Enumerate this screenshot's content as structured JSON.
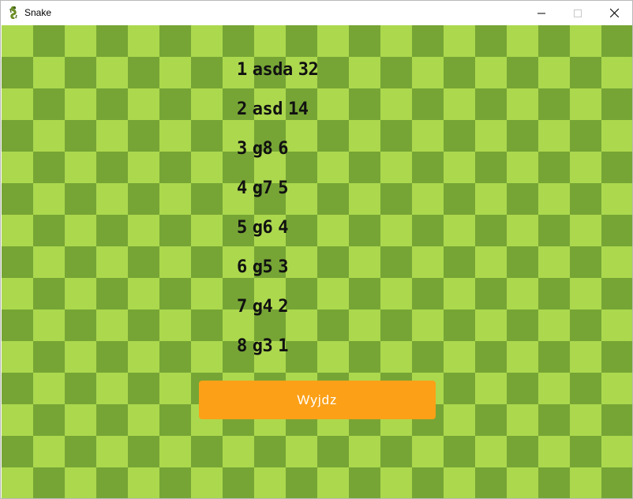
{
  "window": {
    "title": "Snake",
    "app_icon": "snake-app-icon",
    "controls": [
      "minimize-icon",
      "maximize-icon",
      "close-icon"
    ]
  },
  "board": {
    "light_color": "#acd84e",
    "dark_color": "#76a535"
  },
  "leaderboard": [
    {
      "rank": "1",
      "name": "asda",
      "score": "32"
    },
    {
      "rank": "2",
      "name": "asd",
      "score": "14"
    },
    {
      "rank": "3",
      "name": "g8",
      "score": "6"
    },
    {
      "rank": "4",
      "name": "g7",
      "score": "5"
    },
    {
      "rank": "5",
      "name": "g6",
      "score": "4"
    },
    {
      "rank": "6",
      "name": "g5",
      "score": "3"
    },
    {
      "rank": "7",
      "name": "g4",
      "score": "2"
    },
    {
      "rank": "8",
      "name": "g3",
      "score": "1"
    }
  ],
  "exit_button": {
    "label": "Wyjdz",
    "color": "#fca017"
  }
}
